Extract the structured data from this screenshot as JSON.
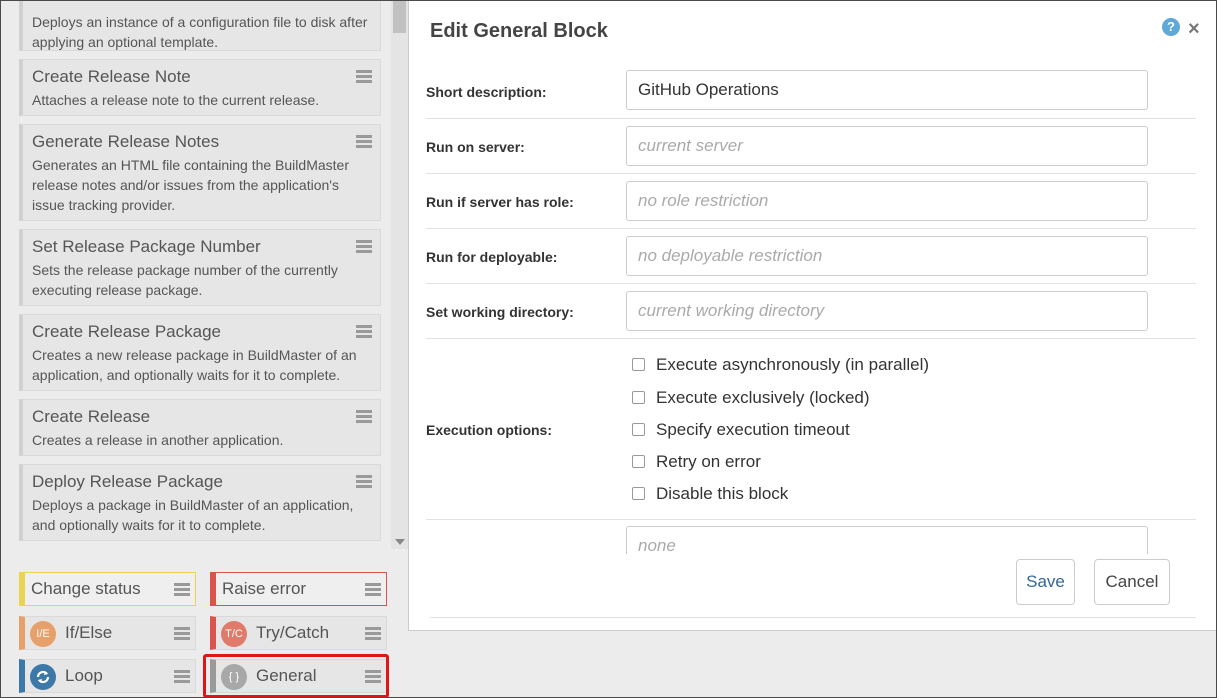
{
  "palette": {
    "operations": [
      {
        "title": "",
        "desc": "Deploys an instance of a configuration file to disk after applying an optional template."
      },
      {
        "title": "Create Release Note",
        "desc": "Attaches a release note to the current release."
      },
      {
        "title": "Generate Release Notes",
        "desc": "Generates an HTML file containing the BuildMaster release notes and/or issues from the application's issue tracking provider."
      },
      {
        "title": "Set Release Package Number",
        "desc": "Sets the release package number of the currently executing release package."
      },
      {
        "title": "Create Release Package",
        "desc": "Creates a new release package in BuildMaster of an application, and optionally waits for it to complete."
      },
      {
        "title": "Create Release",
        "desc": "Creates a release in another application."
      },
      {
        "title": "Deploy Release Package",
        "desc": "Deploys a package in BuildMaster of an application, and optionally waits for it to complete."
      }
    ]
  },
  "blocks": {
    "change_status": "Change status",
    "raise_error": "Raise error",
    "if_else": "If/Else",
    "if_else_icon": "I/E",
    "try_catch": "Try/Catch",
    "try_catch_icon": "T/C",
    "loop": "Loop",
    "general": "General",
    "general_icon": "{ }"
  },
  "modal": {
    "title": "Edit General Block",
    "help": "?",
    "close": "×",
    "fields": {
      "short_description": {
        "label": "Short description:",
        "value": "GitHub Operations"
      },
      "run_on_server": {
        "label": "Run on server:",
        "placeholder": "current server"
      },
      "run_if_role": {
        "label": "Run if server has role:",
        "placeholder": "no role restriction"
      },
      "run_for_deployable": {
        "label": "Run for deployable:",
        "placeholder": "no deployable restriction"
      },
      "working_directory": {
        "label": "Set working directory:",
        "placeholder": "current working directory"
      },
      "extra": {
        "placeholder": "none"
      }
    },
    "execution": {
      "label": "Execution options:",
      "options": [
        "Execute asynchronously (in parallel)",
        "Execute exclusively (locked)",
        "Specify execution timeout",
        "Retry on error",
        "Disable this block"
      ]
    },
    "save": "Save",
    "cancel": "Cancel"
  },
  "colors": {
    "change_status": "#e8d44d",
    "raise_error": "#d9534f",
    "if_else": "#e8a06a",
    "try_catch": "#d9534f",
    "loop": "#3c78a8",
    "general": "#9a9a9a",
    "selection": "#e01515"
  }
}
